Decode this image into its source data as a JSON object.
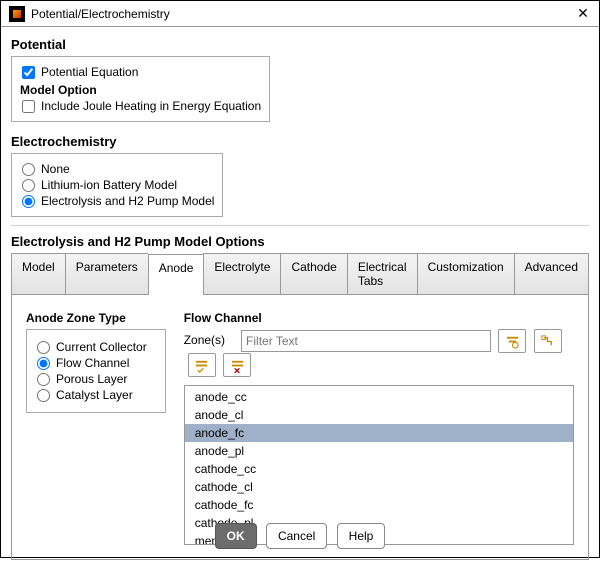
{
  "window": {
    "title": "Potential/Electrochemistry"
  },
  "potential": {
    "title": "Potential",
    "equation_label": "Potential Equation",
    "equation_checked": true,
    "model_option_title": "Model Option",
    "joule_label": "Include Joule Heating in Energy Equation",
    "joule_checked": false
  },
  "electrochem": {
    "title": "Electrochemistry",
    "options": [
      {
        "label": "None",
        "checked": false
      },
      {
        "label": "Lithium-ion Battery Model",
        "checked": false
      },
      {
        "label": "Electrolysis and H2 Pump Model",
        "checked": true
      }
    ]
  },
  "section_title": "Electrolysis and H2 Pump Model Options",
  "tabs": [
    "Model",
    "Parameters",
    "Anode",
    "Electrolyte",
    "Cathode",
    "Electrical Tabs",
    "Customization",
    "Advanced"
  ],
  "active_tab": 2,
  "anode_panel": {
    "zone_type_title": "Anode Zone Type",
    "zone_types": [
      {
        "label": "Current Collector",
        "checked": false
      },
      {
        "label": "Flow Channel",
        "checked": true
      },
      {
        "label": "Porous Layer",
        "checked": false
      },
      {
        "label": "Catalyst Layer",
        "checked": false
      }
    ],
    "flow_channel_title": "Flow Channel",
    "zones_label": "Zone(s)",
    "filter_placeholder": "Filter Text",
    "zones": [
      "anode_cc",
      "anode_cl",
      "anode_fc",
      "anode_pl",
      "cathode_cc",
      "cathode_cl",
      "cathode_fc",
      "cathode_pl",
      "mem"
    ],
    "selected_zone": 2,
    "icon_buttons": [
      "filter-by",
      "toggle-tree",
      "select-all",
      "deselect-all"
    ]
  },
  "footer": {
    "ok": "OK",
    "cancel": "Cancel",
    "help": "Help"
  }
}
